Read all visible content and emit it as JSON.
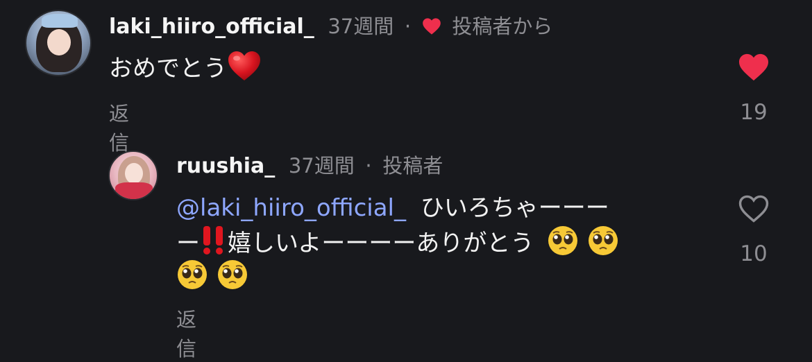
{
  "comment1": {
    "username": "laki_hiiro_official_",
    "time": "37週間",
    "separator": "·",
    "author_like_label": "投稿者から",
    "text": "おめでとう",
    "text_emoji": "red-heart",
    "reply_label": "返信",
    "like_count": "19",
    "liked": true,
    "like_color": "#ef2f4d"
  },
  "comment2": {
    "username": "ruushia_",
    "time": "37週間",
    "separator": "·",
    "author_badge": "投稿者",
    "mention": "@laki_hiiro_official_",
    "line1_text": "ひいろちゃーーー",
    "line2_start": "ー",
    "line2_emoji": "double-exclamation",
    "line2_text": "嬉しいよーーーーありがとう",
    "emoji": "pleading-face",
    "reply_label": "返信",
    "like_count": "10",
    "liked": false
  },
  "colors": {
    "background": "#18191d",
    "muted": "#8e8e93",
    "mention": "#8ea7ff",
    "heart": "#ef2f4d"
  }
}
